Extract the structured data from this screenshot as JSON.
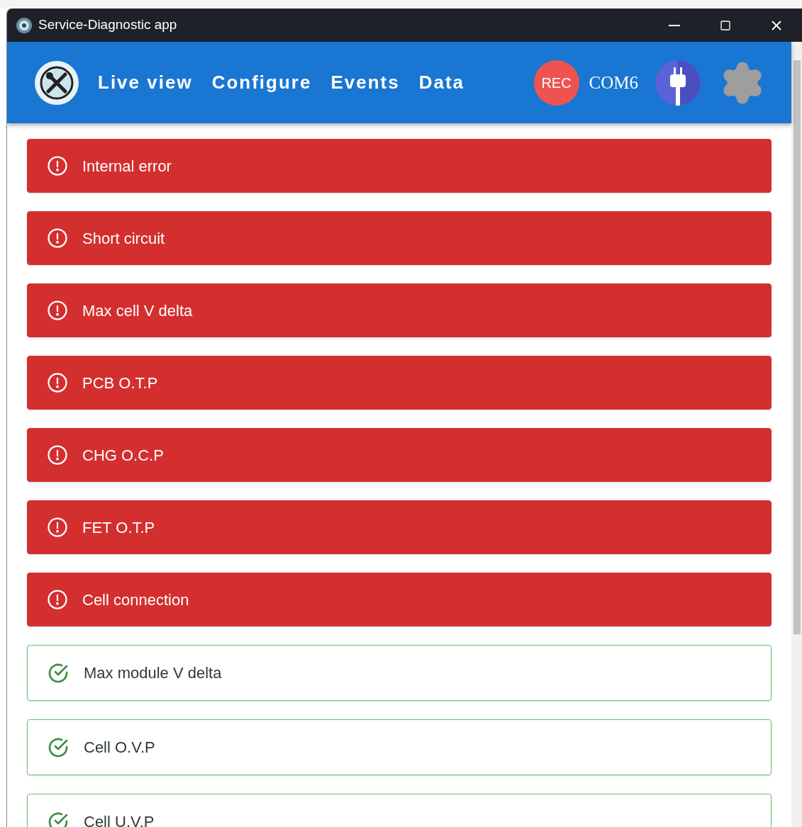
{
  "window": {
    "title": "Service-Diagnostic app"
  },
  "nav": {
    "tabs": [
      {
        "label": "Live view"
      },
      {
        "label": "Configure"
      },
      {
        "label": "Events"
      },
      {
        "label": "Data"
      }
    ],
    "rec": "REC",
    "port": "COM6"
  },
  "alerts": [
    {
      "kind": "error",
      "label": "Internal error"
    },
    {
      "kind": "error",
      "label": "Short circuit"
    },
    {
      "kind": "error",
      "label": "Max cell V delta"
    },
    {
      "kind": "error",
      "label": "PCB O.T.P"
    },
    {
      "kind": "error",
      "label": "CHG O.C.P"
    },
    {
      "kind": "error",
      "label": "FET O.T.P"
    },
    {
      "kind": "error",
      "label": "Cell connection"
    },
    {
      "kind": "ok",
      "label": "Max module V delta"
    },
    {
      "kind": "ok",
      "label": "Cell O.V.P"
    },
    {
      "kind": "ok",
      "label": "Cell U.V.P"
    }
  ]
}
